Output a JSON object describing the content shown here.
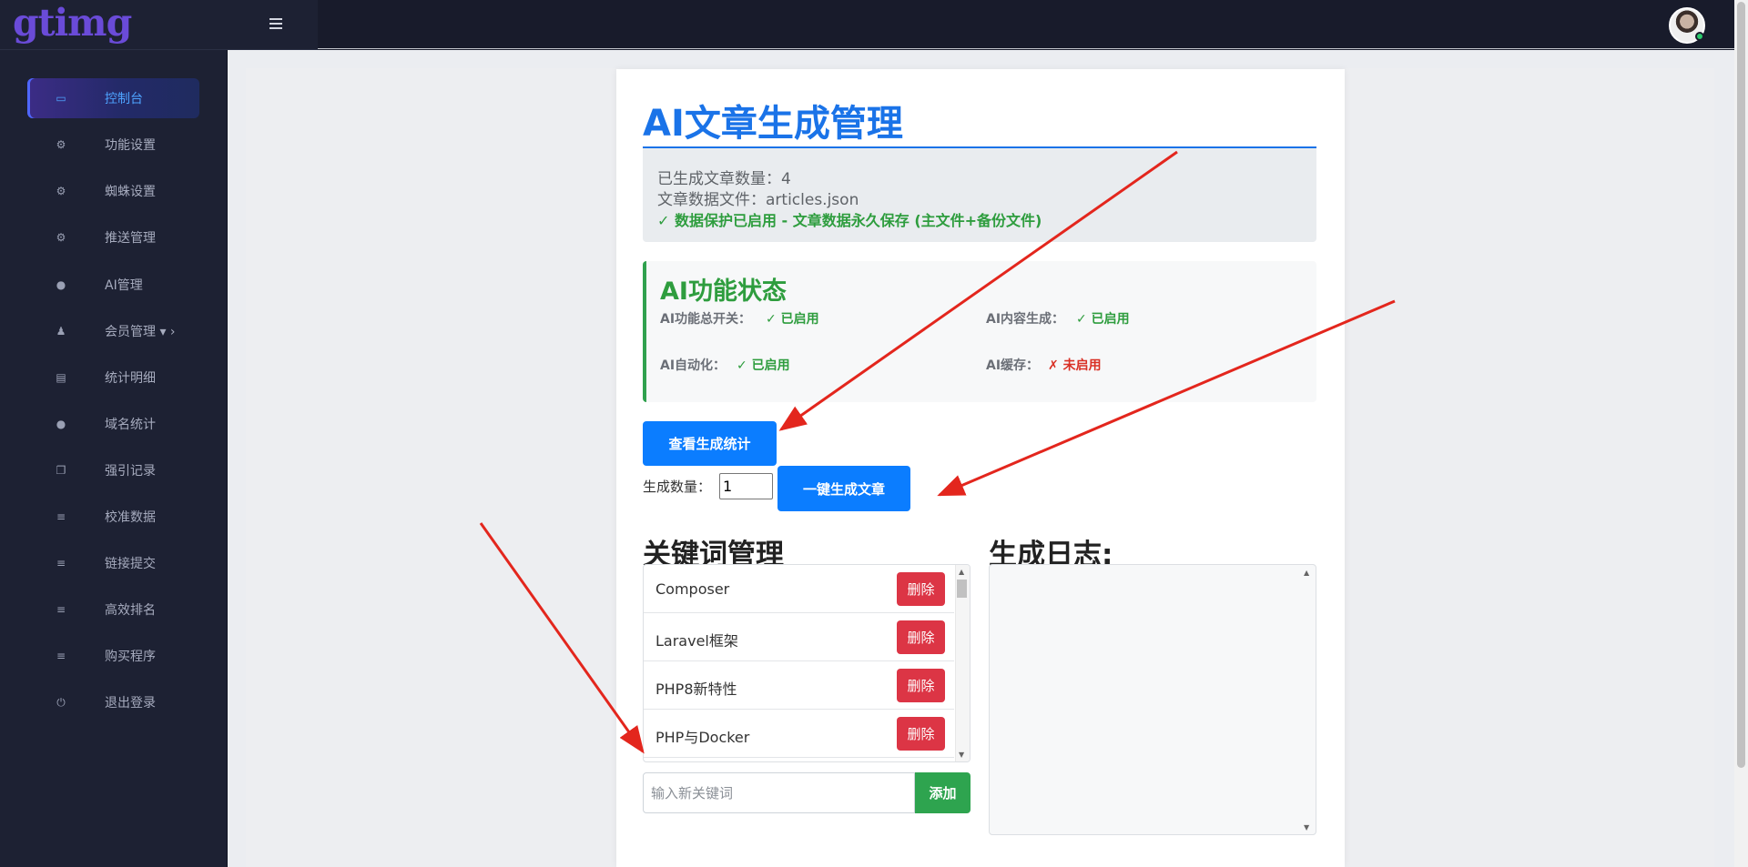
{
  "brand": {
    "logo_text": "gtimg"
  },
  "sidebar": {
    "items": [
      {
        "label": "控制台",
        "icon": "laptop-icon",
        "glyph": "▭",
        "active": true
      },
      {
        "label": "功能设置",
        "icon": "cogs-icon",
        "glyph": "⚙",
        "active": false
      },
      {
        "label": "蜘蛛设置",
        "icon": "cogs-icon",
        "glyph": "⚙",
        "active": false
      },
      {
        "label": "推送管理",
        "icon": "cogs-icon",
        "glyph": "⚙",
        "active": false
      },
      {
        "label": "AI管理",
        "icon": "globe-icon",
        "glyph": "●",
        "active": false
      },
      {
        "label": "会员管理 ▾ ›",
        "icon": "users-icon",
        "glyph": "♟",
        "active": false
      },
      {
        "label": "统计明细",
        "icon": "bar-chart-icon",
        "glyph": "▤",
        "active": false
      },
      {
        "label": "域名统计",
        "icon": "globe-icon",
        "glyph": "●",
        "active": false
      },
      {
        "label": "强引记录",
        "icon": "copy-icon",
        "glyph": "❐",
        "active": false
      },
      {
        "label": "校准数据",
        "icon": "list-icon",
        "glyph": "≡",
        "active": false
      },
      {
        "label": "链接提交",
        "icon": "list-icon",
        "glyph": "≡",
        "active": false
      },
      {
        "label": "高效排名",
        "icon": "list-icon",
        "glyph": "≡",
        "active": false
      },
      {
        "label": "购买程序",
        "icon": "list-icon",
        "glyph": "≡",
        "active": false
      },
      {
        "label": "退出登录",
        "icon": "power-icon",
        "glyph": "⏻",
        "active": false
      }
    ]
  },
  "main": {
    "title": "AI文章生成管理",
    "info": {
      "count_line": "已生成文章数量：4",
      "file_line": "文章数据文件：articles.json",
      "protection_line": "✓ 数据保护已启用 - 文章数据永久保存 (主文件+备份文件)"
    },
    "status": {
      "title": "AI功能状态",
      "items": [
        {
          "label": "AI功能总开关：",
          "value": "✓ 已启用",
          "state": "on"
        },
        {
          "label": "AI内容生成：",
          "value": "✓ 已启用",
          "state": "on"
        },
        {
          "label": "AI自动化：",
          "value": "✓ 已启用",
          "state": "on"
        },
        {
          "label": "AI缓存：",
          "value": "✗ 未启用",
          "state": "off"
        }
      ]
    },
    "actions": {
      "view_stats_label": "查看生成统计",
      "qty_label": "生成数量：",
      "qty_value": "1",
      "generate_label": "一键生成文章"
    },
    "keywords": {
      "heading": "关键词管理",
      "items": [
        "Composer",
        "Laravel框架",
        "PHP8新特性",
        "PHP与Docker"
      ],
      "delete_label": "删除",
      "input_placeholder": "输入新关键词",
      "add_label": "添加"
    },
    "log": {
      "heading": "生成日志:"
    }
  },
  "colors": {
    "accent_blue": "#0b7dff",
    "success_green": "#2e9d3e",
    "danger_red": "#dc3545",
    "sidebar_bg": "#1d2133"
  }
}
